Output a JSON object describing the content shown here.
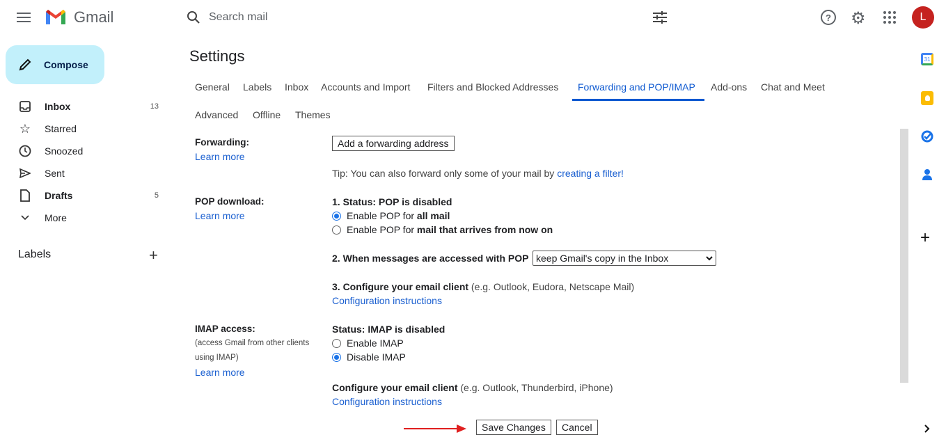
{
  "header": {
    "app_name": "Gmail",
    "search_placeholder": "Search mail",
    "avatar_letter": "L",
    "avatar_color": "#c5221f"
  },
  "sidebar": {
    "compose": "Compose",
    "items": [
      {
        "label": "Inbox",
        "count": "13",
        "bold": true,
        "icon": "inbox-icon"
      },
      {
        "label": "Starred",
        "count": "",
        "icon": "star-icon"
      },
      {
        "label": "Snoozed",
        "count": "",
        "icon": "clock-icon"
      },
      {
        "label": "Sent",
        "count": "",
        "icon": "send-icon"
      },
      {
        "label": "Drafts",
        "count": "5",
        "bold": true,
        "icon": "file-icon"
      },
      {
        "label": "More",
        "count": "",
        "icon": "chevron-down-icon"
      }
    ],
    "labels_heading": "Labels"
  },
  "settings": {
    "title": "Settings",
    "tabs": [
      "General",
      "Labels",
      "Inbox",
      "Accounts and Import",
      "Filters and Blocked Addresses",
      "Forwarding and POP/IMAP",
      "Add-ons",
      "Chat and Meet",
      "Advanced",
      "Offline",
      "Themes"
    ],
    "active_tab": "Forwarding and POP/IMAP",
    "forwarding": {
      "label": "Forwarding:",
      "learn_more": "Learn more",
      "add_button": "Add a forwarding address",
      "tip": "Tip: You can also forward only some of your mail by ",
      "tip_link": "creating a filter!"
    },
    "pop": {
      "label": "POP download:",
      "learn_more": "Learn more",
      "status": "1. Status: POP is disabled",
      "opt1_prefix": "Enable POP for ",
      "opt1_bold": "all mail",
      "opt1_checked": true,
      "opt2_prefix": "Enable POP for ",
      "opt2_bold": "mail that arrives from now on",
      "opt2_checked": false,
      "access_label": "2. When messages are accessed with POP",
      "access_value": "keep Gmail's copy in the Inbox",
      "configure_bold": "3. Configure your email client",
      "configure_rest": " (e.g. Outlook, Eudora, Netscape Mail)",
      "config_link": "Configuration instructions"
    },
    "imap": {
      "label": "IMAP access:",
      "desc1": "(access Gmail from other clients",
      "desc2": "using IMAP)",
      "learn_more": "Learn more",
      "status": "Status: IMAP is disabled",
      "enable": "Enable IMAP",
      "disable": "Disable IMAP",
      "selected": "Disable IMAP",
      "configure_bold": "Configure your email client",
      "configure_rest": " (e.g. Outlook, Thunderbird, iPhone)",
      "config_link": "Configuration instructions"
    },
    "save": "Save Changes",
    "cancel": "Cancel"
  }
}
